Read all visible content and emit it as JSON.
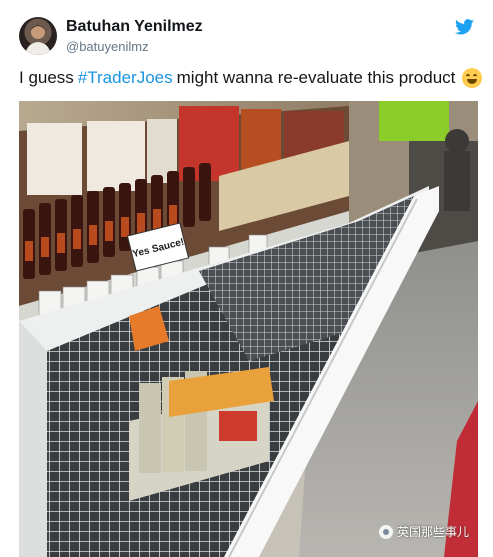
{
  "tweet": {
    "display_name": "Batuhan Yenilmez",
    "handle": "@batuyenilmz",
    "text_before": "I guess",
    "hashtag": "#TraderJoes",
    "text_after": "might wanna re-evaluate this product",
    "emoji": "smiling-face-emoji"
  },
  "photo": {
    "subject": "supermarket-freezer-empty-wire-baskets",
    "sign_text": "Yes Sauce!"
  },
  "watermark": {
    "text": "英国那些事儿"
  },
  "colors": {
    "hashtag": "#1b95e0",
    "twitter_blue": "#1da1f2",
    "handle": "#657786"
  }
}
